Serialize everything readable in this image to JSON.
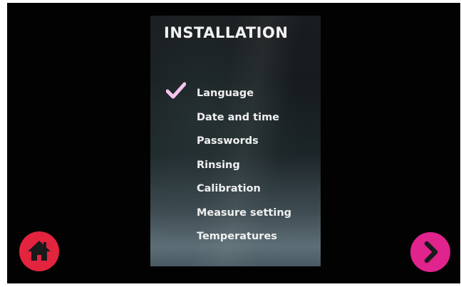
{
  "screen": {
    "title": "INSTALLATION"
  },
  "menu": {
    "items": [
      {
        "label": "Language",
        "checked": true
      },
      {
        "label": "Date and time",
        "checked": false
      },
      {
        "label": "Passwords",
        "checked": false
      },
      {
        "label": "Rinsing",
        "checked": false
      },
      {
        "label": "Calibration",
        "checked": false
      },
      {
        "label": "Measure setting",
        "checked": false
      },
      {
        "label": "Temperatures",
        "checked": false
      }
    ]
  },
  "controls": {
    "home_icon": "home-icon",
    "next_icon": "chevron-right-icon"
  },
  "colors": {
    "home_button": "#e2243f",
    "next_button": "#e0238d",
    "check_mark": "#f4c6ee",
    "frame": "#020202"
  }
}
